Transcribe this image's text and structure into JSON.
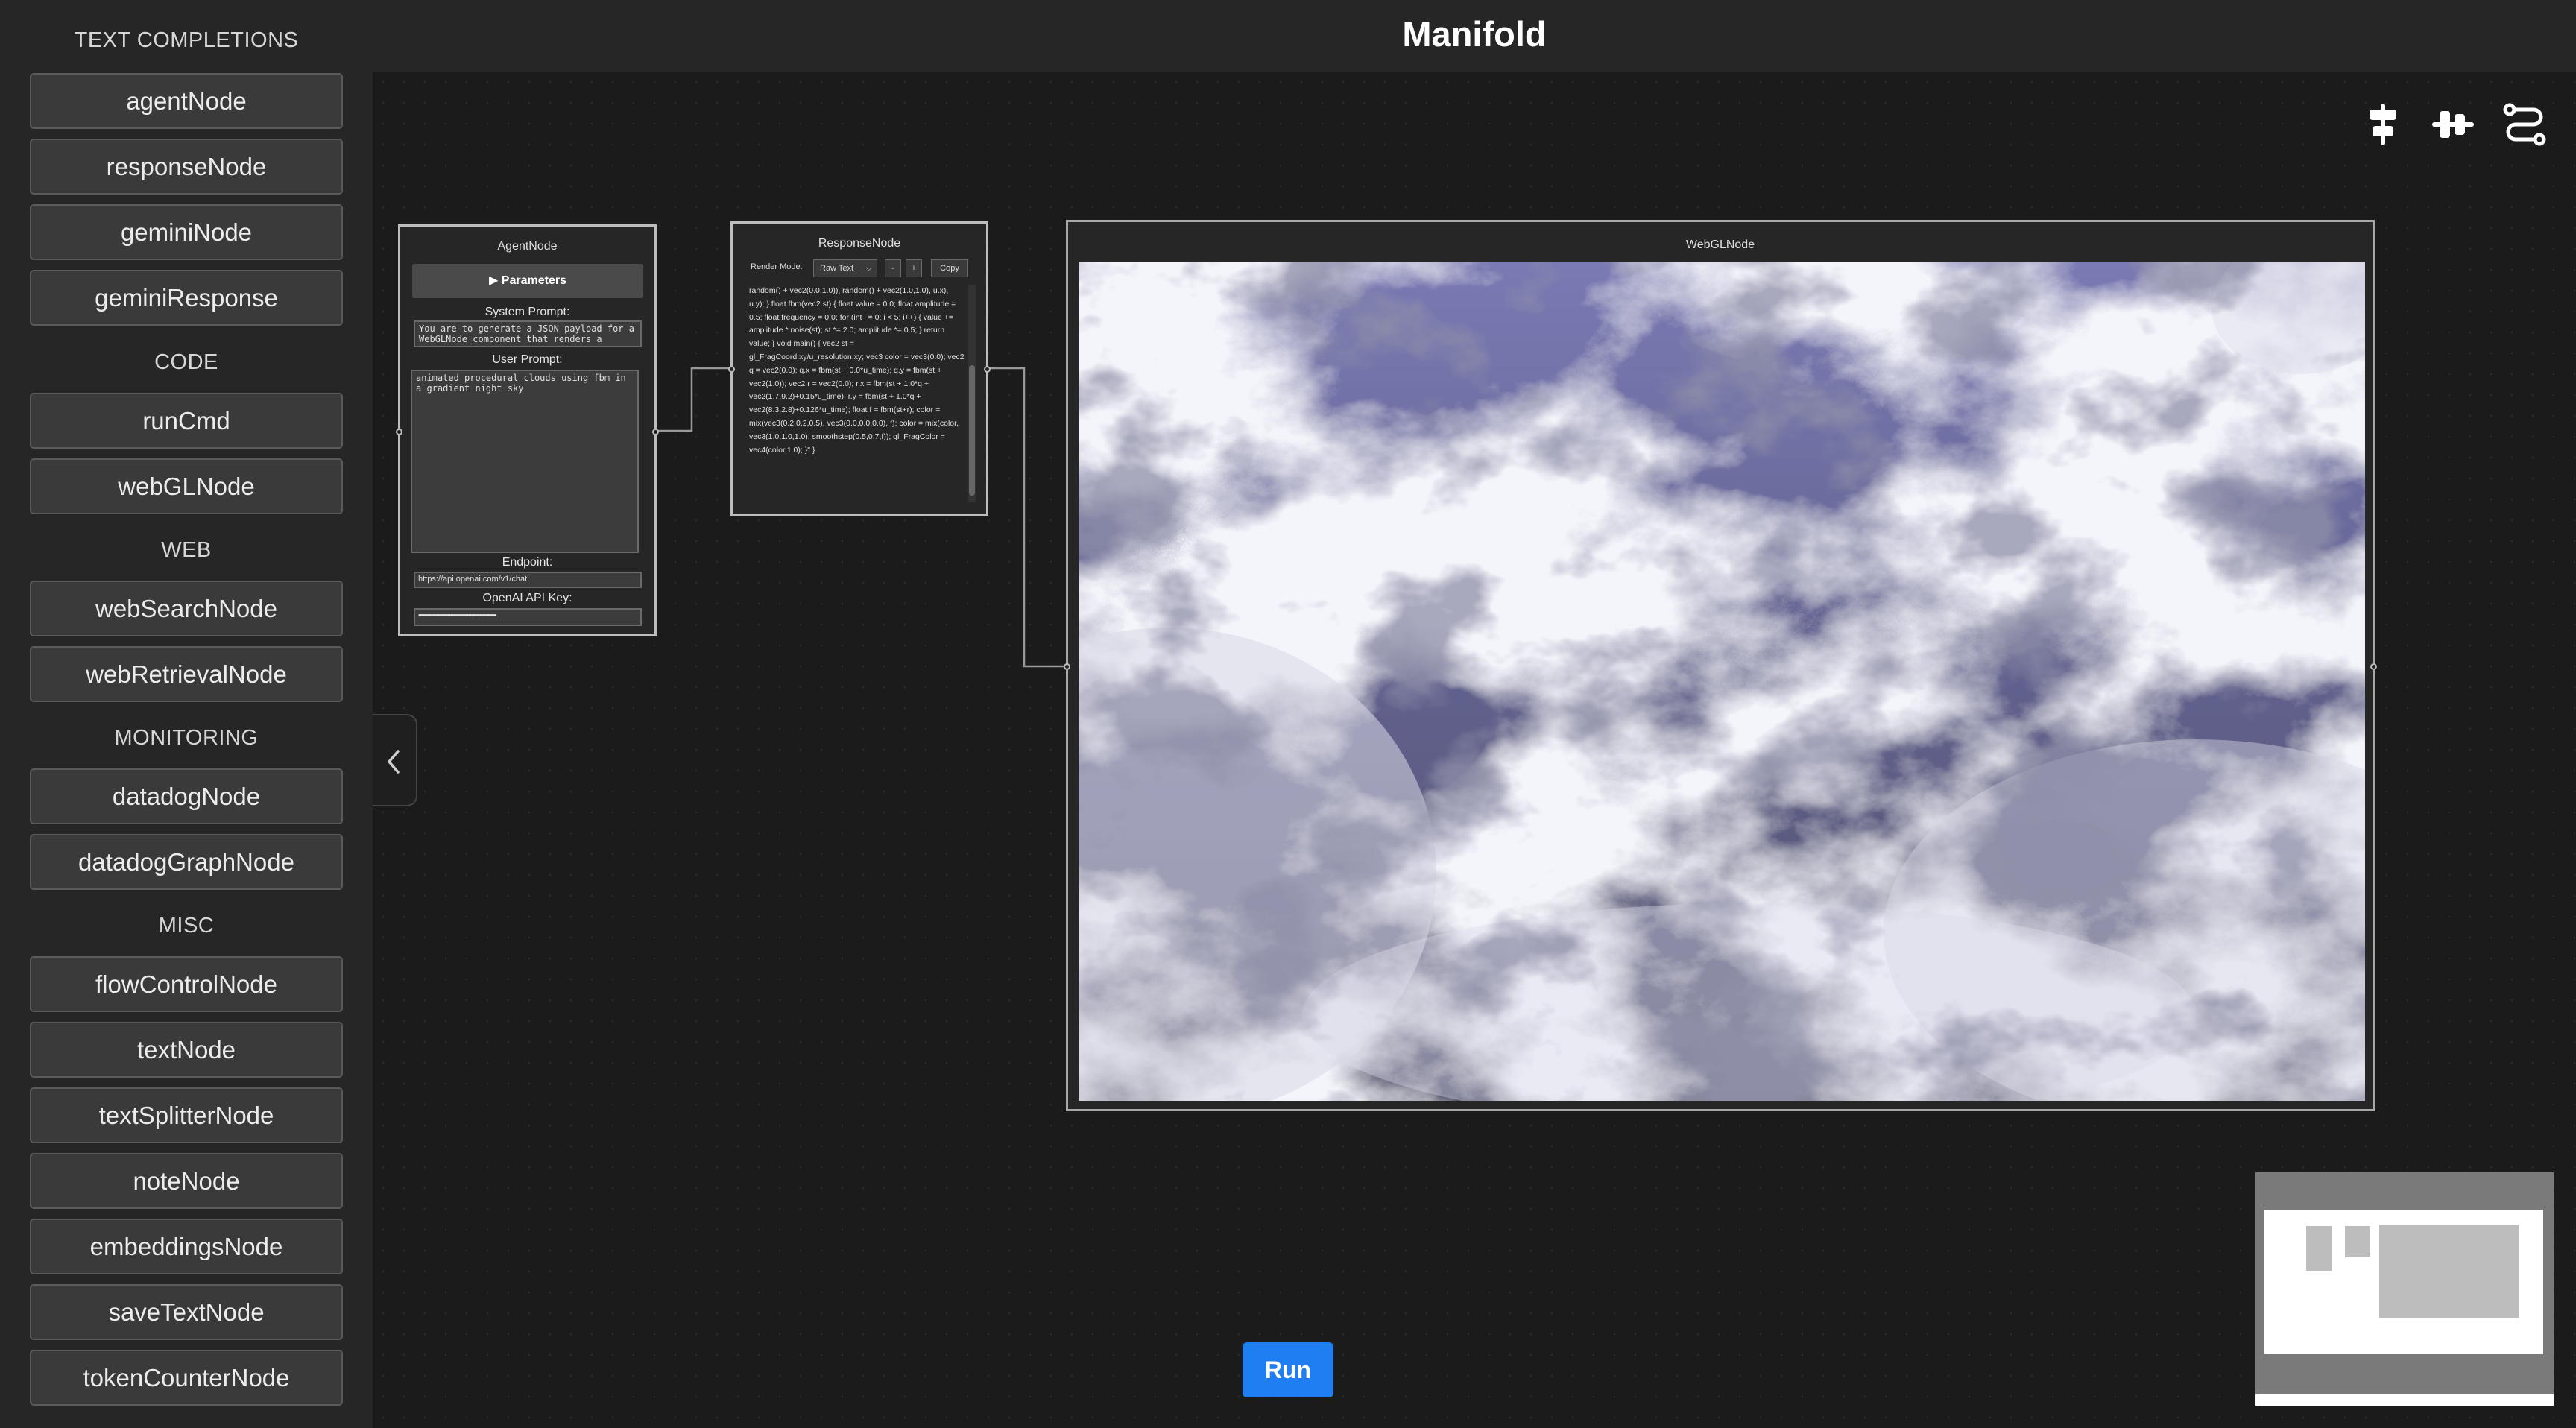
{
  "app": {
    "title": "Manifold"
  },
  "sidebar": {
    "categories": {
      "text_completions": "TEXT COMPLETIONS",
      "code": "CODE",
      "web": "WEB",
      "monitoring": "MONITORING",
      "misc": "MISC"
    },
    "items": {
      "agentNode": "agentNode",
      "responseNode": "responseNode",
      "geminiNode": "geminiNode",
      "geminiResponse": "geminiResponse",
      "runCmd": "runCmd",
      "webGLNode": "webGLNode",
      "webSearchNode": "webSearchNode",
      "webRetrievalNode": "webRetrievalNode",
      "datadogNode": "datadogNode",
      "datadogGraphNode": "datadogGraphNode",
      "flowControlNode": "flowControlNode",
      "textNode": "textNode",
      "textSplitterNode": "textSplitterNode",
      "noteNode": "noteNode",
      "embeddingsNode": "embeddingsNode",
      "saveTextNode": "saveTextNode",
      "tokenCounterNode": "tokenCounterNode"
    }
  },
  "agent_node": {
    "title": "AgentNode",
    "parameters_label": "▶ Parameters",
    "system_prompt_label": "System Prompt:",
    "system_prompt_value": "You are to generate a JSON payload for a WebGLNode component that renders a",
    "user_prompt_label": "User Prompt:",
    "user_prompt_value": "animated procedural clouds using fbm in a gradient night sky",
    "endpoint_label": "Endpoint:",
    "endpoint_value": "https://api.openai.com/v1/chat",
    "api_key_label": "OpenAI API Key:",
    "api_key_value": "••••••••••••••••••••••••••••••••••••••••••••••••••••••••"
  },
  "response_node": {
    "title": "ResponseNode",
    "render_mode_label": "Render Mode:",
    "render_mode_value": "Raw Text",
    "minus_label": "-",
    "plus_label": "+",
    "copy_label": "Copy",
    "body": "random() + vec2(0.0,1.0)), random() + vec2(1.0,1.0), u.x), u.y); } float fbm(vec2 st) { float value = 0.0; float amplitude = 0.5; float frequency = 0.0; for (int i = 0; i < 5; i++) { value += amplitude * noise(st); st *= 2.0; amplitude *= 0.5; } return value; } void main() { vec2 st = gl_FragCoord.xy/u_resolution.xy; vec3 color = vec3(0.0); vec2 q = vec2(0.0); q.x = fbm(st + 0.0*u_time); q.y = fbm(st + vec2(1.0)); vec2 r = vec2(0.0); r.x = fbm(st + 1.0*q + vec2(1.7,9.2)+0.15*u_time); r.y = fbm(st + 1.0*q + vec2(8.3,2.8)+0.126*u_time); float f = fbm(st+r); color = mix(vec3(0.2,0.2,0.5), vec3(0.0,0.0,0.0), f); color = mix(color, vec3(1.0,1.0,1.0), smoothstep(0.5,0.7,f)); gl_FragColor = vec4(color,1.0); }\" }"
  },
  "webgl_node": {
    "title": "WebGLNode"
  },
  "run_button": {
    "label": "Run"
  },
  "colors": {
    "accent": "#1f7ff2",
    "node_border": "#bdbdbd",
    "sky_top": "#7a7ab8",
    "sky_bottom": "#4e4e6e"
  },
  "icons": [
    "align-vertical-icon",
    "align-horizontal-icon",
    "route-icon",
    "chevron-left-icon"
  ]
}
